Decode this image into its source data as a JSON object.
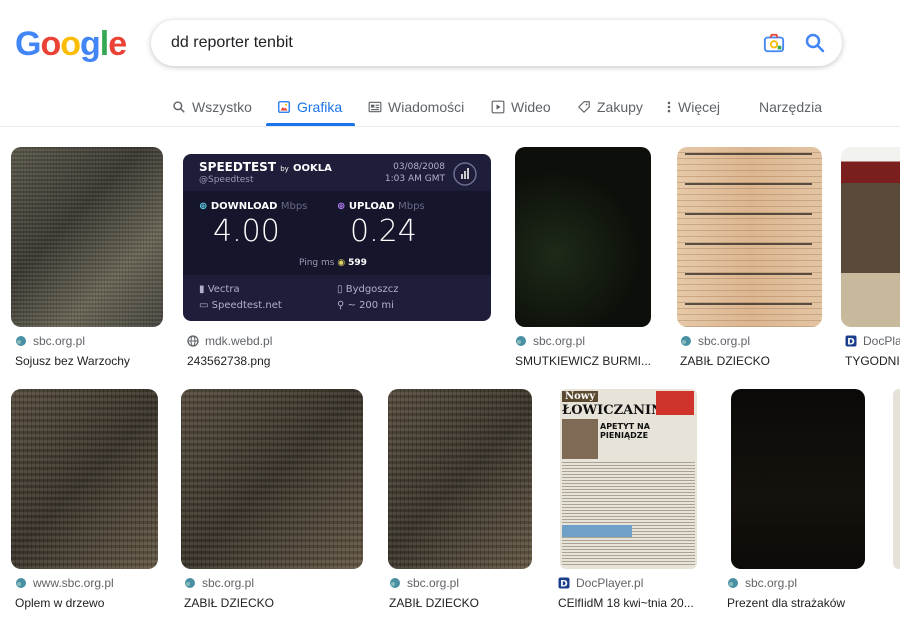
{
  "logo": {
    "letters": [
      "G",
      "o",
      "o",
      "g",
      "l",
      "e"
    ],
    "colors": [
      "#4285F4",
      "#EA4335",
      "#FBBC05",
      "#4285F4",
      "#34A853",
      "#EA4335"
    ]
  },
  "search": {
    "query": "dd reporter tenbit"
  },
  "tabs": [
    {
      "label": "Wszystko",
      "icon": "search-icon"
    },
    {
      "label": "Grafika",
      "icon": "image-icon",
      "active": true
    },
    {
      "label": "Wiadomości",
      "icon": "news-icon"
    },
    {
      "label": "Wideo",
      "icon": "play-icon"
    },
    {
      "label": "Zakupy",
      "icon": "tag-icon"
    },
    {
      "label": "Więcej",
      "icon": "more-vert-icon"
    },
    {
      "label": "Narzędzia"
    }
  ],
  "results_row1": [
    {
      "source": "sbc.org.pl",
      "title": "Sojusz bez Warzochy"
    },
    {
      "source": "mdk.webd.pl",
      "title": "243562738.png"
    },
    {
      "source": "sbc.org.pl",
      "title": "SMUTKIEWICZ BURMI..."
    },
    {
      "source": "sbc.org.pl",
      "title": "ZABIŁ DZIECKO"
    },
    {
      "source": "DocPla",
      "title": "TYGODNIK"
    }
  ],
  "results_row2": [
    {
      "source": "www.sbc.org.pl",
      "title": "Oplem w drzewo"
    },
    {
      "source": "sbc.org.pl",
      "title": "ZABIŁ DZIECKO"
    },
    {
      "source": "sbc.org.pl",
      "title": "ZABIŁ DZIECKO"
    },
    {
      "source": "DocPlayer.pl",
      "title": "CElfIidM 18 kwi~tnia 20..."
    },
    {
      "source": "sbc.org.pl",
      "title": "Prezent dla strażaków"
    }
  ],
  "speedtest": {
    "brand": "SPEEDTEST",
    "by": "by",
    "brand2": "OOKLA",
    "handle": "@Speedtest",
    "date": "03/08/2008",
    "time": "1:03 AM GMT",
    "download_label": "DOWNLOAD",
    "upload_label": "UPLOAD",
    "unit": "Mbps",
    "download": "4.00",
    "upload": "0.24",
    "ping_label": "Ping",
    "ping_unit": "ms",
    "ping": "599",
    "isp": "Vectra",
    "server_city": "Bydgoszcz",
    "host": "Speedtest.net",
    "distance": "~ 200 mi"
  },
  "newspaper": {
    "masthead1": "Nowy",
    "masthead2": "ŁOWICZANIN",
    "headline": "APETYT NA PIENIĄDZE"
  }
}
